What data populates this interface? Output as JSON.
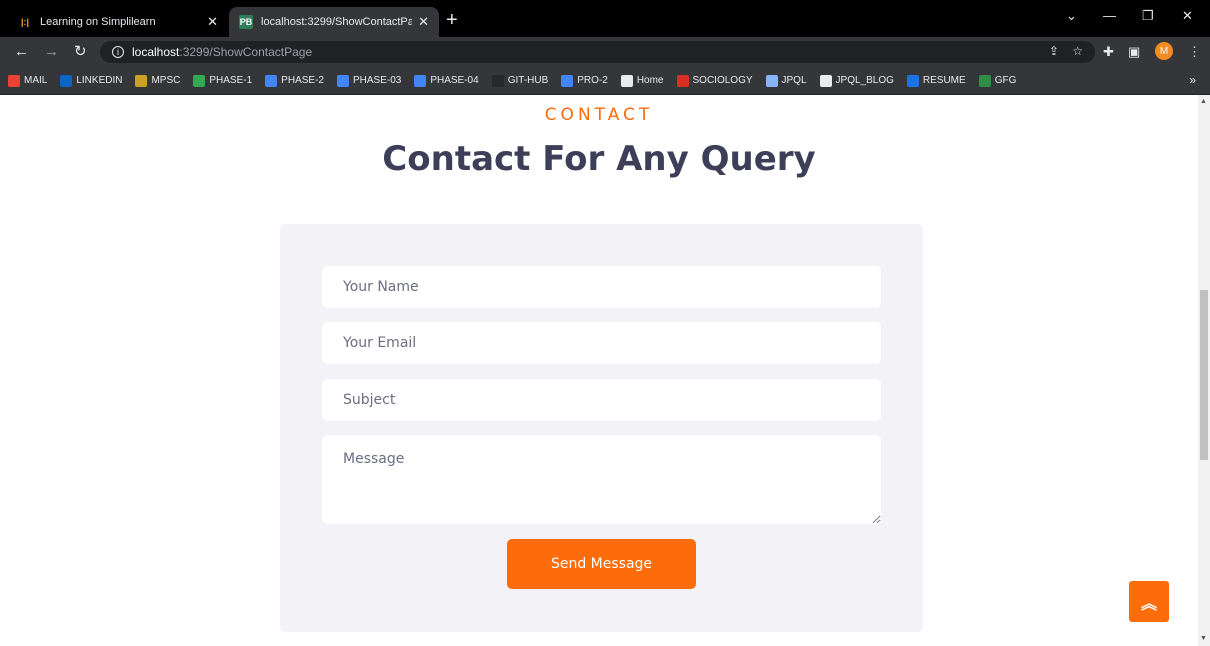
{
  "browser": {
    "tabs": [
      {
        "title": "Learning on Simplilearn",
        "favicon": "simplilearn-icon",
        "active": false
      },
      {
        "title": "localhost:3299/ShowContactPage",
        "favicon": "pb-icon",
        "active": true
      }
    ],
    "url": {
      "host": "localhost",
      "path": ":3299/ShowContactPage"
    },
    "profile_initial": "M",
    "bookmarks": [
      {
        "label": "MAIL",
        "icon": "gmail-icon",
        "color": "#ea4335"
      },
      {
        "label": "LINKEDIN",
        "icon": "linkedin-icon",
        "color": "#0a66c2"
      },
      {
        "label": "MPSC",
        "icon": "emblem-icon",
        "color": "#c9a227"
      },
      {
        "label": "PHASE-1",
        "icon": "drive-icon",
        "color": "#34a853"
      },
      {
        "label": "PHASE-2",
        "icon": "docs-icon",
        "color": "#4285f4"
      },
      {
        "label": "PHASE-03",
        "icon": "docs-icon",
        "color": "#4285f4"
      },
      {
        "label": "PHASE-04",
        "icon": "docs-icon",
        "color": "#4285f4"
      },
      {
        "label": "GIT-HUB",
        "icon": "github-icon",
        "color": "#24292e"
      },
      {
        "label": "PRO-2",
        "icon": "docs-icon",
        "color": "#4285f4"
      },
      {
        "label": "Home",
        "icon": "globe-icon",
        "color": "#e8eaed"
      },
      {
        "label": "SOCIOLOGY",
        "icon": "sociology-icon",
        "color": "#d93025"
      },
      {
        "label": "JPQL",
        "icon": "jpql-icon",
        "color": "#8ab4f8"
      },
      {
        "label": "JPQL_BLOG",
        "icon": "globe-icon",
        "color": "#e8eaed"
      },
      {
        "label": "RESUME",
        "icon": "novoresume-icon",
        "color": "#1a73e8"
      },
      {
        "label": "GFG",
        "icon": "gfg-icon",
        "color": "#2f8d46"
      }
    ]
  },
  "page": {
    "eyebrow": "CONTACT",
    "heading": "Contact For Any Query",
    "form": {
      "name_placeholder": "Your Name",
      "email_placeholder": "Your Email",
      "subject_placeholder": "Subject",
      "message_placeholder": "Message",
      "submit_label": "Send Message"
    },
    "accent_color": "#fd6c0b",
    "heading_color": "#3d3f59"
  }
}
